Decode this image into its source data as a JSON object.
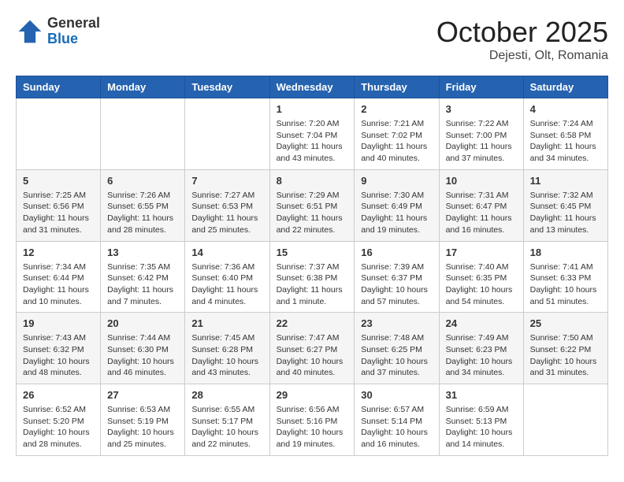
{
  "header": {
    "logo_general": "General",
    "logo_blue": "Blue",
    "month_title": "October 2025",
    "location": "Dejesti, Olt, Romania"
  },
  "days_of_week": [
    "Sunday",
    "Monday",
    "Tuesday",
    "Wednesday",
    "Thursday",
    "Friday",
    "Saturday"
  ],
  "weeks": [
    [
      null,
      null,
      null,
      {
        "day": "1",
        "sunrise": "7:20 AM",
        "sunset": "7:04 PM",
        "daylight": "11 hours and 43 minutes."
      },
      {
        "day": "2",
        "sunrise": "7:21 AM",
        "sunset": "7:02 PM",
        "daylight": "11 hours and 40 minutes."
      },
      {
        "day": "3",
        "sunrise": "7:22 AM",
        "sunset": "7:00 PM",
        "daylight": "11 hours and 37 minutes."
      },
      {
        "day": "4",
        "sunrise": "7:24 AM",
        "sunset": "6:58 PM",
        "daylight": "11 hours and 34 minutes."
      }
    ],
    [
      {
        "day": "5",
        "sunrise": "7:25 AM",
        "sunset": "6:56 PM",
        "daylight": "11 hours and 31 minutes."
      },
      {
        "day": "6",
        "sunrise": "7:26 AM",
        "sunset": "6:55 PM",
        "daylight": "11 hours and 28 minutes."
      },
      {
        "day": "7",
        "sunrise": "7:27 AM",
        "sunset": "6:53 PM",
        "daylight": "11 hours and 25 minutes."
      },
      {
        "day": "8",
        "sunrise": "7:29 AM",
        "sunset": "6:51 PM",
        "daylight": "11 hours and 22 minutes."
      },
      {
        "day": "9",
        "sunrise": "7:30 AM",
        "sunset": "6:49 PM",
        "daylight": "11 hours and 19 minutes."
      },
      {
        "day": "10",
        "sunrise": "7:31 AM",
        "sunset": "6:47 PM",
        "daylight": "11 hours and 16 minutes."
      },
      {
        "day": "11",
        "sunrise": "7:32 AM",
        "sunset": "6:45 PM",
        "daylight": "11 hours and 13 minutes."
      }
    ],
    [
      {
        "day": "12",
        "sunrise": "7:34 AM",
        "sunset": "6:44 PM",
        "daylight": "11 hours and 10 minutes."
      },
      {
        "day": "13",
        "sunrise": "7:35 AM",
        "sunset": "6:42 PM",
        "daylight": "11 hours and 7 minutes."
      },
      {
        "day": "14",
        "sunrise": "7:36 AM",
        "sunset": "6:40 PM",
        "daylight": "11 hours and 4 minutes."
      },
      {
        "day": "15",
        "sunrise": "7:37 AM",
        "sunset": "6:38 PM",
        "daylight": "11 hours and 1 minute."
      },
      {
        "day": "16",
        "sunrise": "7:39 AM",
        "sunset": "6:37 PM",
        "daylight": "10 hours and 57 minutes."
      },
      {
        "day": "17",
        "sunrise": "7:40 AM",
        "sunset": "6:35 PM",
        "daylight": "10 hours and 54 minutes."
      },
      {
        "day": "18",
        "sunrise": "7:41 AM",
        "sunset": "6:33 PM",
        "daylight": "10 hours and 51 minutes."
      }
    ],
    [
      {
        "day": "19",
        "sunrise": "7:43 AM",
        "sunset": "6:32 PM",
        "daylight": "10 hours and 48 minutes."
      },
      {
        "day": "20",
        "sunrise": "7:44 AM",
        "sunset": "6:30 PM",
        "daylight": "10 hours and 46 minutes."
      },
      {
        "day": "21",
        "sunrise": "7:45 AM",
        "sunset": "6:28 PM",
        "daylight": "10 hours and 43 minutes."
      },
      {
        "day": "22",
        "sunrise": "7:47 AM",
        "sunset": "6:27 PM",
        "daylight": "10 hours and 40 minutes."
      },
      {
        "day": "23",
        "sunrise": "7:48 AM",
        "sunset": "6:25 PM",
        "daylight": "10 hours and 37 minutes."
      },
      {
        "day": "24",
        "sunrise": "7:49 AM",
        "sunset": "6:23 PM",
        "daylight": "10 hours and 34 minutes."
      },
      {
        "day": "25",
        "sunrise": "7:50 AM",
        "sunset": "6:22 PM",
        "daylight": "10 hours and 31 minutes."
      }
    ],
    [
      {
        "day": "26",
        "sunrise": "6:52 AM",
        "sunset": "5:20 PM",
        "daylight": "10 hours and 28 minutes."
      },
      {
        "day": "27",
        "sunrise": "6:53 AM",
        "sunset": "5:19 PM",
        "daylight": "10 hours and 25 minutes."
      },
      {
        "day": "28",
        "sunrise": "6:55 AM",
        "sunset": "5:17 PM",
        "daylight": "10 hours and 22 minutes."
      },
      {
        "day": "29",
        "sunrise": "6:56 AM",
        "sunset": "5:16 PM",
        "daylight": "10 hours and 19 minutes."
      },
      {
        "day": "30",
        "sunrise": "6:57 AM",
        "sunset": "5:14 PM",
        "daylight": "10 hours and 16 minutes."
      },
      {
        "day": "31",
        "sunrise": "6:59 AM",
        "sunset": "5:13 PM",
        "daylight": "10 hours and 14 minutes."
      },
      null
    ]
  ]
}
